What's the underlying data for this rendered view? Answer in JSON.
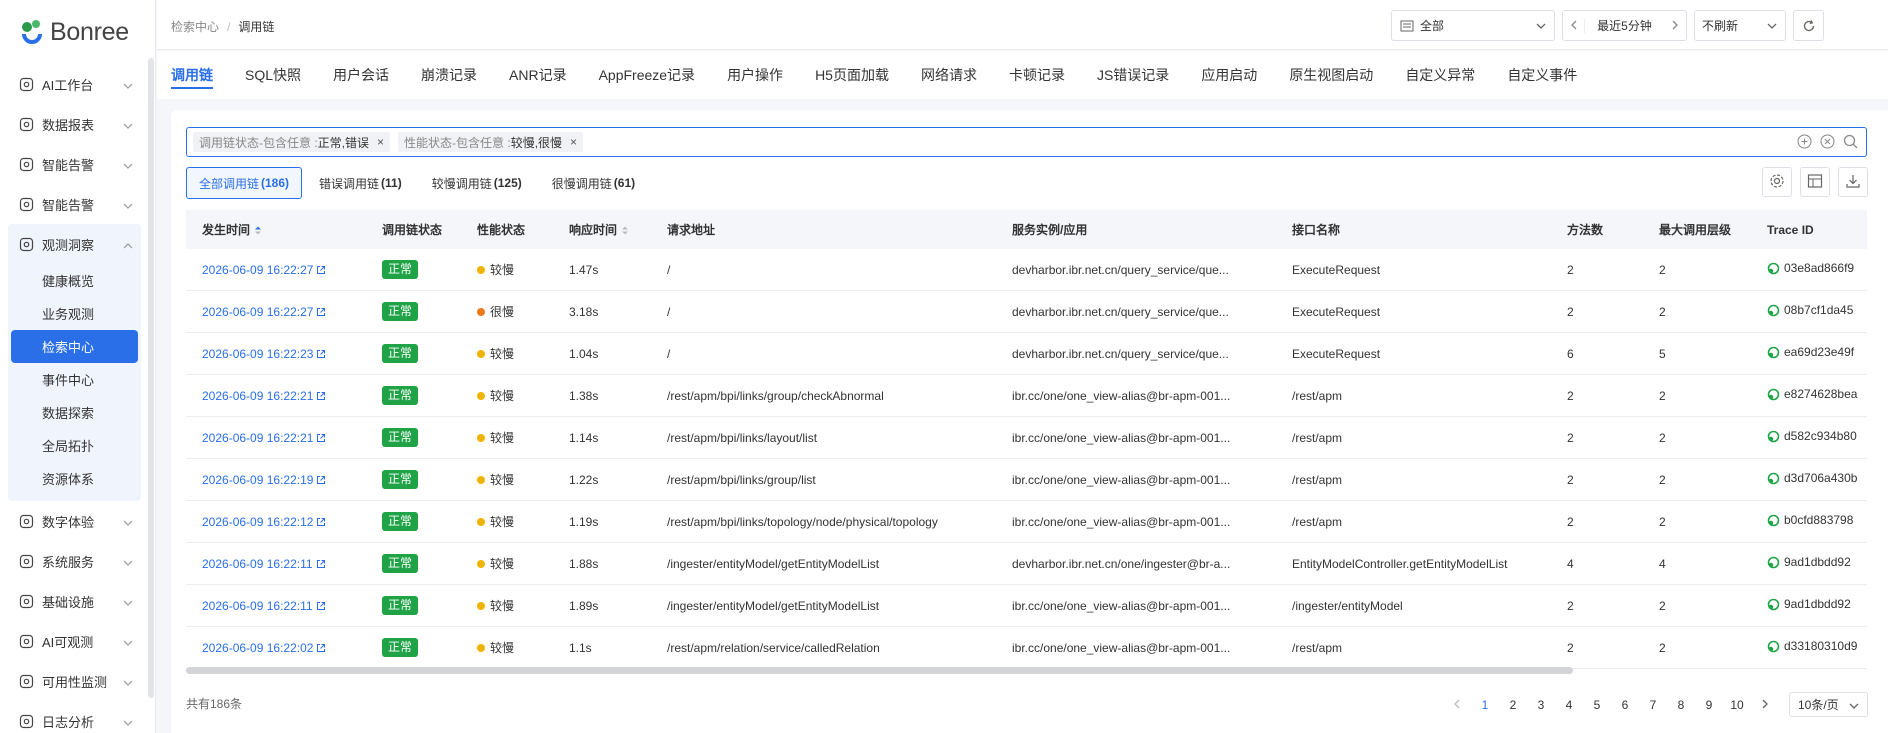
{
  "brand": {
    "name": "Bonree"
  },
  "sidebar": {
    "items": [
      {
        "label": "AI工作台",
        "icon": "ai-workbench-icon"
      },
      {
        "label": "数据报表",
        "icon": "report-icon"
      },
      {
        "label": "智能告警",
        "icon": "alarm-icon"
      },
      {
        "label": "智能告警",
        "icon": "alarm-icon"
      }
    ],
    "group": {
      "label": "观测洞察",
      "icon": "observe-icon",
      "children": [
        "健康概览",
        "业务观测",
        "检索中心",
        "事件中心",
        "数据探索",
        "全局拓扑",
        "资源体系"
      ],
      "active": "检索中心"
    },
    "items_after": [
      {
        "label": "数字体验",
        "icon": "digital-experience-icon"
      },
      {
        "label": "系统服务",
        "icon": "system-service-icon"
      },
      {
        "label": "基础设施",
        "icon": "infrastructure-icon"
      },
      {
        "label": "AI可观测",
        "icon": "ai-observe-icon"
      },
      {
        "label": "可用性监测",
        "icon": "availability-icon"
      },
      {
        "label": "日志分析",
        "icon": "log-icon"
      }
    ]
  },
  "topbar": {
    "breadcrumb": [
      "检索中心",
      "调用链"
    ],
    "app_select": "全部",
    "time_range": "最近5分钟",
    "refresh": "不刷新"
  },
  "tabs": [
    "调用链",
    "SQL快照",
    "用户会话",
    "崩溃记录",
    "ANR记录",
    "AppFreeze记录",
    "用户操作",
    "H5页面加载",
    "网络请求",
    "卡顿记录",
    "JS错误记录",
    "应用启动",
    "原生视图启动",
    "自定义异常",
    "自定义事件"
  ],
  "active_tab": "调用链",
  "filters": [
    {
      "key": "调用链状态-包含任意 :",
      "value": "正常,错误"
    },
    {
      "key": "性能状态-包含任意 :",
      "value": "较慢,很慢"
    }
  ],
  "subtabs": [
    {
      "label": "全部调用链",
      "count": "(186)"
    },
    {
      "label": "错误调用链",
      "count": "(11)"
    },
    {
      "label": "较慢调用链",
      "count": "(125)"
    },
    {
      "label": "很慢调用链",
      "count": "(61)"
    }
  ],
  "table": {
    "headers": [
      "发生时间",
      "调用链状态",
      "性能状态",
      "响应时间",
      "请求地址",
      "服务实例/应用",
      "接口名称",
      "方法数",
      "最大调用层级",
      "Trace ID"
    ],
    "rows": [
      {
        "time": "2026-06-09 16:22:27",
        "status": "正常",
        "perf": "较慢",
        "perf_color": "#f0b400",
        "resp": "1.47s",
        "url": "/",
        "service": "devharbor.ibr.net.cn/query_service/que...",
        "api": "ExecuteRequest",
        "methods": "2",
        "depth": "2",
        "trace": "03e8ad866f9"
      },
      {
        "time": "2026-06-09 16:22:27",
        "status": "正常",
        "perf": "很慢",
        "perf_color": "#f07a1a",
        "resp": "3.18s",
        "url": "/",
        "service": "devharbor.ibr.net.cn/query_service/que...",
        "api": "ExecuteRequest",
        "methods": "2",
        "depth": "2",
        "trace": "08b7cf1da45"
      },
      {
        "time": "2026-06-09 16:22:23",
        "status": "正常",
        "perf": "较慢",
        "perf_color": "#f0b400",
        "resp": "1.04s",
        "url": "/",
        "service": "devharbor.ibr.net.cn/query_service/que...",
        "api": "ExecuteRequest",
        "methods": "6",
        "depth": "5",
        "trace": "ea69d23e49f"
      },
      {
        "time": "2026-06-09 16:22:21",
        "status": "正常",
        "perf": "较慢",
        "perf_color": "#f0b400",
        "resp": "1.38s",
        "url": "/rest/apm/bpi/links/group/checkAbnormal",
        "service": "ibr.cc/one/one_view-alias@br-apm-001...",
        "api": "/rest/apm",
        "methods": "2",
        "depth": "2",
        "trace": "e8274628bea"
      },
      {
        "time": "2026-06-09 16:22:21",
        "status": "正常",
        "perf": "较慢",
        "perf_color": "#f0b400",
        "resp": "1.14s",
        "url": "/rest/apm/bpi/links/layout/list",
        "service": "ibr.cc/one/one_view-alias@br-apm-001...",
        "api": "/rest/apm",
        "methods": "2",
        "depth": "2",
        "trace": "d582c934b80"
      },
      {
        "time": "2026-06-09 16:22:19",
        "status": "正常",
        "perf": "较慢",
        "perf_color": "#f0b400",
        "resp": "1.22s",
        "url": "/rest/apm/bpi/links/group/list",
        "service": "ibr.cc/one/one_view-alias@br-apm-001...",
        "api": "/rest/apm",
        "methods": "2",
        "depth": "2",
        "trace": "d3d706a430b"
      },
      {
        "time": "2026-06-09 16:22:12",
        "status": "正常",
        "perf": "较慢",
        "perf_color": "#f0b400",
        "resp": "1.19s",
        "url": "/rest/apm/bpi/links/topology/node/physical/topology",
        "service": "ibr.cc/one/one_view-alias@br-apm-001...",
        "api": "/rest/apm",
        "methods": "2",
        "depth": "2",
        "trace": "b0cfd883798"
      },
      {
        "time": "2026-06-09 16:22:11",
        "status": "正常",
        "perf": "较慢",
        "perf_color": "#f0b400",
        "resp": "1.88s",
        "url": "/ingester/entityModel/getEntityModelList",
        "service": "devharbor.ibr.net.cn/one/ingester@br-a...",
        "api": "EntityModelController.getEntityModelList",
        "methods": "4",
        "depth": "4",
        "trace": "9ad1dbdd92"
      },
      {
        "time": "2026-06-09 16:22:11",
        "status": "正常",
        "perf": "较慢",
        "perf_color": "#f0b400",
        "resp": "1.89s",
        "url": "/ingester/entityModel/getEntityModelList",
        "service": "ibr.cc/one/one_view-alias@br-apm-001...",
        "api": "/ingester/entityModel",
        "methods": "2",
        "depth": "2",
        "trace": "9ad1dbdd92"
      },
      {
        "time": "2026-06-09 16:22:02",
        "status": "正常",
        "perf": "较慢",
        "perf_color": "#f0b400",
        "resp": "1.1s",
        "url": "/rest/apm/relation/service/calledRelation",
        "service": "ibr.cc/one/one_view-alias@br-apm-001...",
        "api": "/rest/apm",
        "methods": "2",
        "depth": "2",
        "trace": "d33180310d9"
      }
    ]
  },
  "footer": {
    "total": "共有186条",
    "pages": [
      "1",
      "2",
      "3",
      "4",
      "5",
      "6",
      "7",
      "8",
      "9",
      "10"
    ],
    "current_page": "1",
    "page_size": "10条/页"
  },
  "colors": {
    "primary": "#2a6fe8",
    "status_normal": "#1fa346",
    "slow": "#f0b400",
    "very_slow": "#f07a1a"
  }
}
